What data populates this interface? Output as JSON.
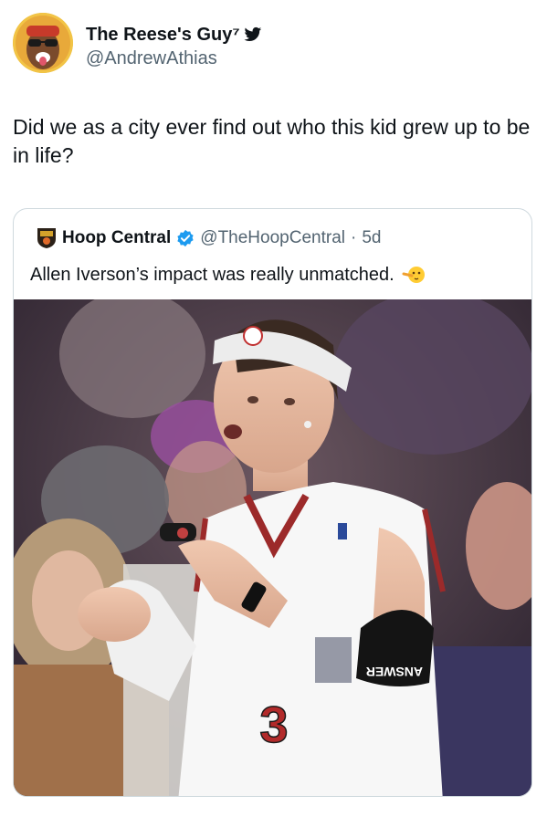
{
  "author": {
    "display_name": "The Reese's Guy⁷",
    "handle": "@AndrewAthias",
    "avatar_icon": "avatar-sunglasses",
    "badge_icon": "twitter-bird-icon"
  },
  "tweet": {
    "text": "Did we as a city ever find out who this kid grew up to be in life?"
  },
  "quoted_tweet": {
    "display_name": "Hoop Central",
    "handle": "@TheHoopCentral",
    "separator": "·",
    "age": "5d",
    "text": "Allen Iverson’s impact was really unmatched.",
    "emoji": "shushing-face",
    "verified_color": "#1d9bf0"
  },
  "photo": {
    "jersey_number": "3",
    "arm_sleeve_text": "ANSWER"
  }
}
